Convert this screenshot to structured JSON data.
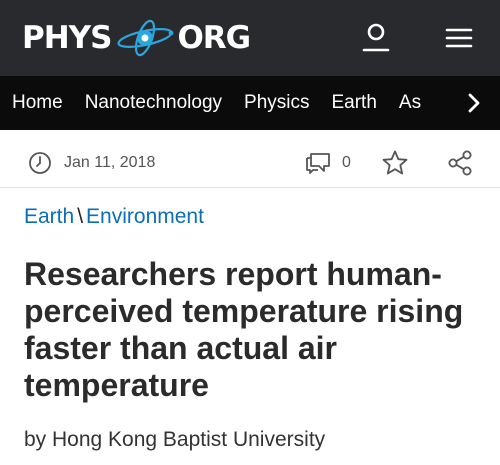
{
  "header": {
    "logo_left": "PHYS",
    "logo_right": "ORG",
    "icons": {
      "user": "user-icon",
      "menu": "hamburger-menu-icon"
    }
  },
  "nav": {
    "items": [
      "Home",
      "Nanotechnology",
      "Physics",
      "Earth",
      "As"
    ],
    "more_icon": "chevron-right-icon"
  },
  "meta": {
    "date": "Jan 11, 2018",
    "comment_count": "0",
    "icons": {
      "date": "clock-icon",
      "comments": "comment-icon",
      "bookmark": "star-icon",
      "share": "share-icon"
    }
  },
  "breadcrumb": {
    "section": "Earth",
    "separator": "\\",
    "subsection": "Environment"
  },
  "article": {
    "title": "Researchers report human-perceived temperature rising faster than actual air temperature",
    "byline": "by Hong Kong Baptist University"
  },
  "colors": {
    "header_bg": "#282a2e",
    "nav_bg": "#0b0b0b",
    "link": "#0a6fb8",
    "logo_accent": "#2aa7e0"
  }
}
